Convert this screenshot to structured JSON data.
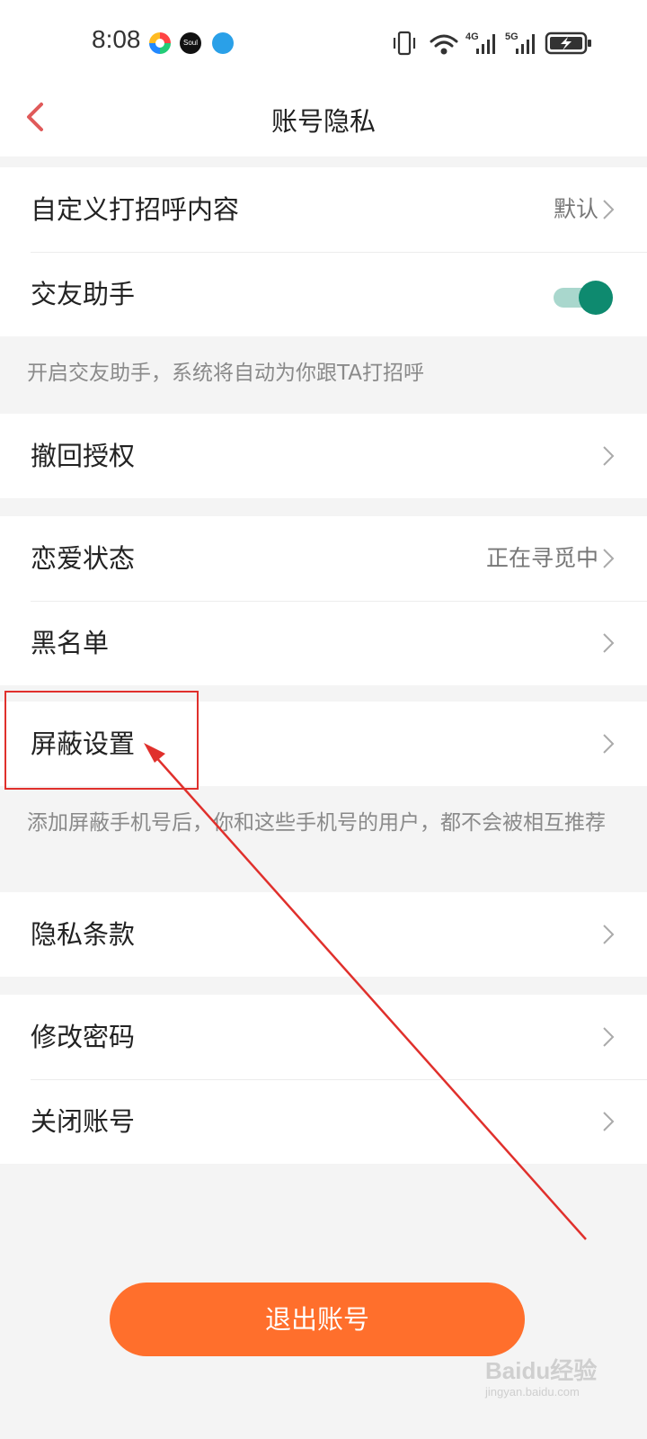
{
  "status_bar": {
    "time": "8:08",
    "app_icons": [
      "colorful-app-icon",
      "soul-app-icon",
      "blue-app-icon"
    ],
    "soul_label": "Soul",
    "signal_labels": [
      "4G",
      "5G"
    ]
  },
  "header": {
    "title": "账号隐私"
  },
  "group1": {
    "greeting": {
      "label": "自定义打招呼内容",
      "value": "默认"
    },
    "assistant": {
      "label": "交友助手",
      "enabled": true
    }
  },
  "note1": "开启交友助手，系统将自动为你跟TA打招呼",
  "group2": {
    "revoke": {
      "label": "撤回授权"
    }
  },
  "group3": {
    "relationship": {
      "label": "恋爱状态",
      "value": "正在寻觅中"
    },
    "blacklist": {
      "label": "黑名单"
    }
  },
  "group4": {
    "block": {
      "label": "屏蔽设置"
    }
  },
  "note2": "添加屏蔽手机号后，你和这些手机号的用户，都不会被相互推荐",
  "group5": {
    "privacy_terms": {
      "label": "隐私条款"
    }
  },
  "group6": {
    "change_password": {
      "label": "修改密码"
    },
    "close_account": {
      "label": "关闭账号"
    }
  },
  "logout_label": "退出账号",
  "colors": {
    "accent": "#ff6f2c",
    "toggle_on": "#0e8a6f",
    "back_arrow": "#e05a5a",
    "annotation": "#e0302c"
  },
  "watermark": {
    "logo": "Baidu经验",
    "sub": "jingyan.baidu.com"
  }
}
